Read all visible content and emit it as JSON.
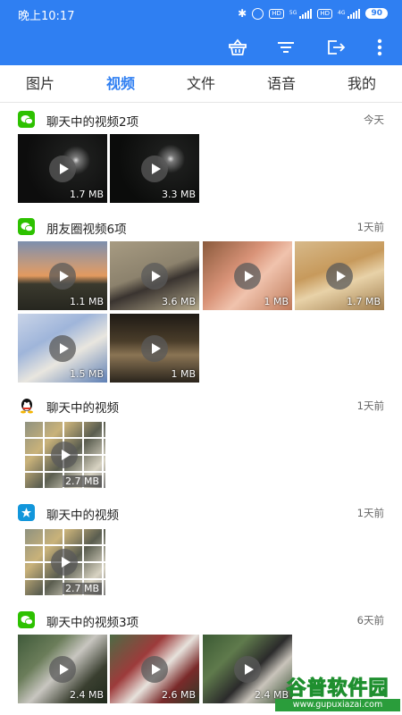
{
  "status": {
    "time": "晚上10:17",
    "icons": [
      "bluetooth-icon",
      "alarm-icon",
      "hd-icon",
      "signal-icon",
      "hd-icon",
      "signal-icon"
    ],
    "net1": "5G",
    "net2": "4G",
    "hd": "HD",
    "battery": "90"
  },
  "toolbar": {
    "icons": [
      "basket-icon",
      "filter-icon",
      "export-icon",
      "more-icon"
    ]
  },
  "tabs": [
    {
      "label": "图片",
      "active": false
    },
    {
      "label": "视频",
      "active": true
    },
    {
      "label": "文件",
      "active": false
    },
    {
      "label": "语音",
      "active": false
    },
    {
      "label": "我的",
      "active": false
    }
  ],
  "sections": [
    {
      "app_icon": "wechat-icon",
      "title": "聊天中的视频2项",
      "time": "今天",
      "videos": [
        {
          "size": "1.7 MB"
        },
        {
          "size": "3.3 MB"
        }
      ]
    },
    {
      "app_icon": "wechat-icon",
      "title": "朋友圈视频6项",
      "time": "1天前",
      "videos": [
        {
          "size": "1.1 MB"
        },
        {
          "size": "3.6 MB"
        },
        {
          "size": "1 MB"
        },
        {
          "size": "1.7 MB"
        },
        {
          "size": "1.5 MB"
        },
        {
          "size": "1 MB"
        }
      ]
    },
    {
      "app_icon": "qq-icon",
      "title": "聊天中的视频",
      "time": "1天前",
      "videos": [
        {
          "size": "2.7 MB"
        }
      ]
    },
    {
      "app_icon": "qq-lite-icon",
      "title": "聊天中的视频",
      "time": "1天前",
      "videos": [
        {
          "size": "2.7 MB"
        }
      ]
    },
    {
      "app_icon": "wechat-icon",
      "title": "聊天中的视频3项",
      "time": "6天前",
      "videos": [
        {
          "size": "2.4 MB"
        },
        {
          "size": "2.6 MB"
        },
        {
          "size": "2.4 MB"
        }
      ]
    }
  ],
  "watermark": {
    "text": "谷普软件园",
    "url": "www.gupuxiazai.com"
  },
  "colors": {
    "accent": "#2f7ff2",
    "wechat": "#2dc100",
    "qq": "#1296db"
  }
}
